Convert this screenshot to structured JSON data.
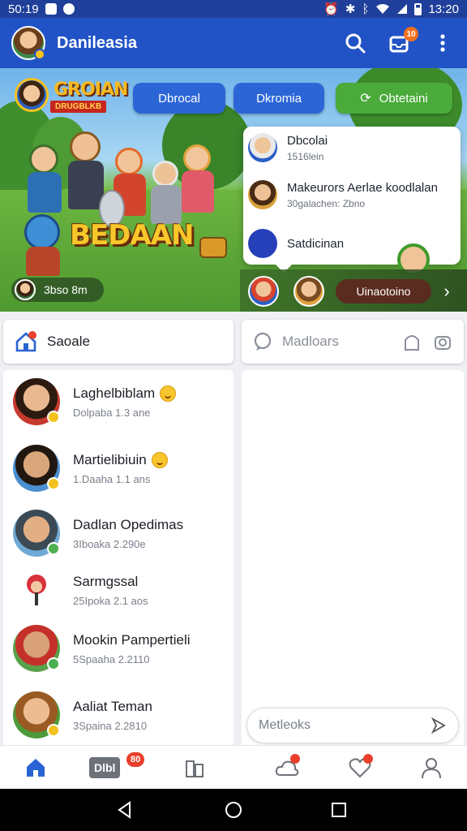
{
  "status_bar": {
    "time_left": "50:19",
    "time_right": "13:20"
  },
  "app": {
    "title": "Danileasia",
    "notification_count": "10"
  },
  "colors": {
    "primary": "#2253c6",
    "status_bar": "#1f3f9a",
    "accent_green": "#4aaa3a",
    "badge": "#f2701d"
  },
  "hero": {
    "logo_title": "GROIAN",
    "logo_subtitle": "DRUGBLKB",
    "tabs": [
      {
        "label": "Dbrocal"
      },
      {
        "label": "Dkromia"
      },
      {
        "label": "Obtetaini"
      }
    ],
    "game_title": "BEDAAN",
    "user_pill": "3bso 8m",
    "popup": [
      {
        "title": "Dbcolai",
        "subtitle": "1516lein"
      },
      {
        "title": "Makeurors Aerlae koodlalan",
        "subtitle": "30galachen: Zbno"
      },
      {
        "title": "Satdicinan",
        "subtitle": ""
      }
    ],
    "bottom_pill": "Uinaotoino"
  },
  "search": {
    "left_label": "Saoale",
    "right_placeholder": "Madloars"
  },
  "contacts": [
    {
      "name": "Laghelbiblam",
      "subtitle": "Dolpaba 1.3 ane",
      "emoji": true
    },
    {
      "name": "Martielibiuin",
      "subtitle": "1.Daaha 1.1 ans",
      "emoji": true
    },
    {
      "name": "Dadlan Opedimas",
      "subtitle": "3Iboaka 2.290e",
      "emoji": false
    },
    {
      "name": "Sarmgssal",
      "subtitle": "25Ipoka 2.1 aos",
      "emoji": false
    },
    {
      "name": "Mookin Pampertieli",
      "subtitle": "5Spaaha 2.2110",
      "emoji": false
    },
    {
      "name": "Aaliat Teman",
      "subtitle": "3Spaina 2.2810",
      "emoji": false
    }
  ],
  "message_input": {
    "placeholder": "Metleoks"
  },
  "bottom_nav": {
    "pill_label": "Dlbl",
    "pill_badge": "80"
  }
}
